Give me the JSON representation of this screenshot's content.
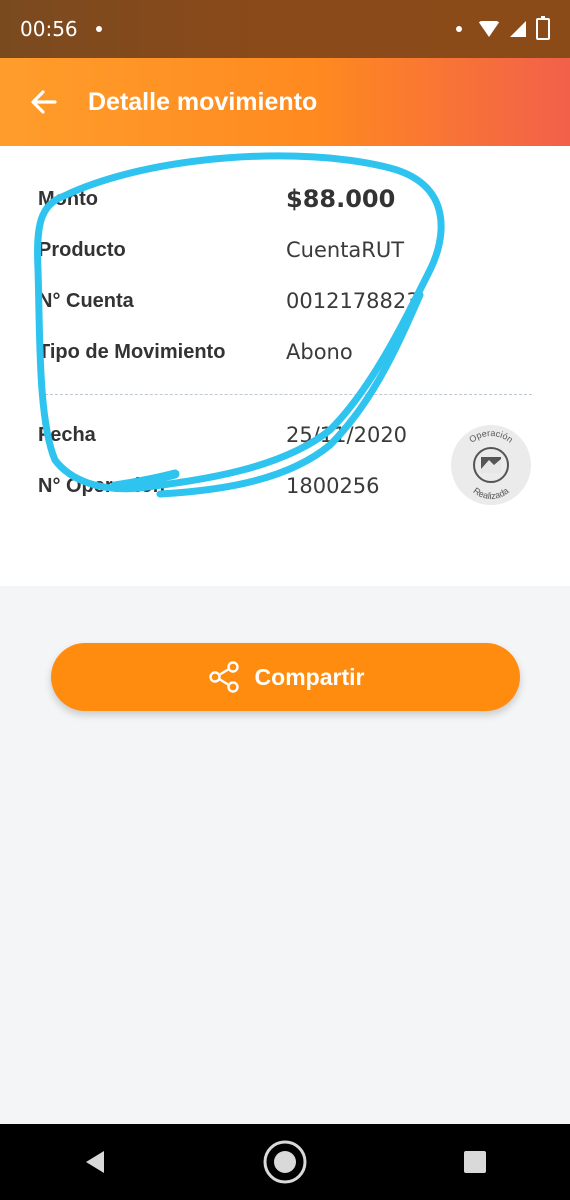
{
  "status_bar": {
    "time": "00:56"
  },
  "header": {
    "title": "Detalle movimiento"
  },
  "details": [
    {
      "label": "Monto",
      "value": "$88.000"
    },
    {
      "label": "Producto",
      "value": "CuentaRUT"
    },
    {
      "label": "N° Cuenta",
      "value": "0012178823"
    },
    {
      "label": "Tipo de Movimiento",
      "value": "Abono"
    },
    {
      "label": "Fecha",
      "value": "25/11/2020"
    },
    {
      "label": "N° Operación",
      "value": "1800256"
    }
  ],
  "stamp": {
    "top_text": "Operación",
    "bottom_text": "Realizada"
  },
  "actions": {
    "share_label": "Compartir"
  },
  "colors": {
    "accent": "#ff8c0f",
    "header_start": "#ff9d2b",
    "header_end": "#f2604a",
    "annotation": "#2ec4ef"
  },
  "icons": [
    "back-arrow-icon",
    "share-icon",
    "wifi-icon",
    "signal-icon",
    "battery-icon",
    "nav-back-icon",
    "nav-home-icon",
    "nav-recents-icon"
  ]
}
